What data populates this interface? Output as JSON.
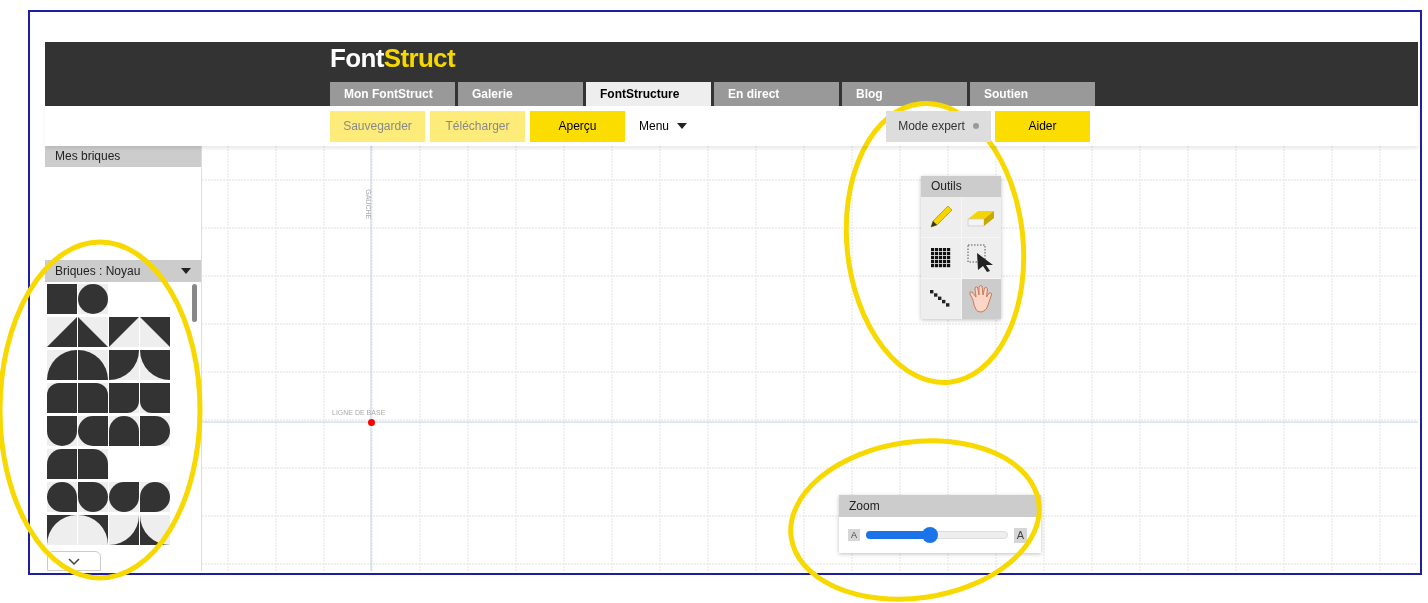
{
  "logo": {
    "first": "Font",
    "second": "Struct"
  },
  "tabs": [
    {
      "label": "Mon FontStruct",
      "selected": false
    },
    {
      "label": "Galerie",
      "selected": false
    },
    {
      "label": "FontStructure",
      "selected": true
    },
    {
      "label": "En direct",
      "selected": false
    },
    {
      "label": "Blog",
      "selected": false
    },
    {
      "label": "Soutien",
      "selected": false
    }
  ],
  "toolbar": {
    "buttons": [
      {
        "label": "Sauvegarder",
        "disabled": true
      },
      {
        "label": "Télécharger",
        "disabled": true
      },
      {
        "label": "Aperçu",
        "disabled": false
      }
    ],
    "menu": "Menu",
    "mode_expert": {
      "label": "Mode expert",
      "on": false
    },
    "help": "Aider"
  },
  "sidebar": {
    "my_bricks": "Mes briques",
    "library": "Briques : Noyau"
  },
  "canvas": {
    "left_label": "GAUCHE",
    "baseline_label": "LIGNE DE BASE"
  },
  "tools_panel": {
    "title": "Outils",
    "tools": [
      {
        "kind": "pencil",
        "selected": false
      },
      {
        "kind": "eraser",
        "selected": false
      },
      {
        "kind": "fill",
        "selected": false
      },
      {
        "kind": "select",
        "selected": false
      },
      {
        "kind": "line",
        "selected": false
      },
      {
        "kind": "hand",
        "selected": true
      }
    ]
  },
  "zoom_panel": {
    "title": "Zoom",
    "level": 0.45,
    "small_glyph": "A",
    "large_glyph": "A"
  }
}
